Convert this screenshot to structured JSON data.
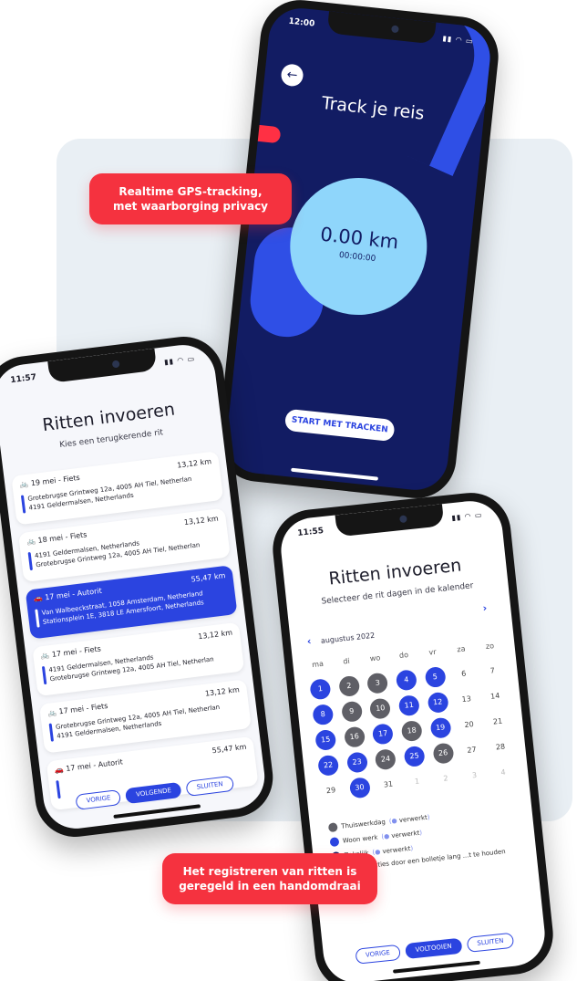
{
  "colors": {
    "brand_blue": "#2b44e0",
    "navy": "#121c63",
    "light_blue": "#8fd6fb",
    "red": "#f5323f",
    "panel": "#e9eff4"
  },
  "badges": {
    "gps": [
      "Realtime GPS-tracking,",
      "met waarborging privacy"
    ],
    "register": [
      "Het registreren van ritten is",
      "geregeld in een handomdraai"
    ]
  },
  "track": {
    "status_time": "12:00",
    "back_icon": "arrow-left-icon",
    "title": "Track je reis",
    "distance": "0.00 km",
    "duration": "00:00:00",
    "start_button": "START MET TRACKEN"
  },
  "list": {
    "status_time": "11:57",
    "title": "Ritten invoeren",
    "subtitle": "Kies een terugkerende rit",
    "rides": [
      {
        "label": "19 mei - Fiets",
        "icon": "bike-icon",
        "km": "13,12 km",
        "from": "Grotebrugse Grintweg 12a, 4005 AH Tiel, Netherlan",
        "to": "4191 Geldermalsen, Netherlands",
        "active": false
      },
      {
        "label": "18 mei - Fiets",
        "icon": "bike-icon",
        "km": "13,12 km",
        "from": "4191 Geldermalsen, Netherlands",
        "to": "Grotebrugse Grintweg 12a, 4005 AH Tiel, Netherlan",
        "active": false
      },
      {
        "label": "17 mei - Autorit",
        "icon": "car-icon",
        "km": "55,47 km",
        "from": "Van Walbeeckstraat, 1058 Amsterdam, Netherland",
        "to": "Stationsplein 1E, 3818 LE Amersfoort, Netherlands",
        "active": true
      },
      {
        "label": "17 mei - Fiets",
        "icon": "bike-icon",
        "km": "13,12 km",
        "from": "4191 Geldermalsen, Netherlands",
        "to": "Grotebrugse Grintweg 12a, 4005 AH Tiel, Netherlan",
        "active": false
      },
      {
        "label": "17 mei - Fiets",
        "icon": "bike-icon",
        "km": "13,12 km",
        "from": "Grotebrugse Grintweg 12a, 4005 AH Tiel, Netherlan",
        "to": "4191 Geldermalsen, Netherlands",
        "active": false
      },
      {
        "label": "17 mei - Autorit",
        "icon": "car-icon",
        "km": "55,47 km",
        "from": "",
        "to": "",
        "active": false
      }
    ],
    "buttons": {
      "prev": "VORIGE",
      "next": "VOLGENDE",
      "close": "SLUITEN"
    }
  },
  "calendar": {
    "status_time": "11:55",
    "title": "Ritten invoeren",
    "subtitle": "Selecteer de rit dagen in de kalender",
    "month": "augustus 2022",
    "weekdays": [
      "ma",
      "di",
      "wo",
      "do",
      "vr",
      "za",
      "zo"
    ],
    "weeks": [
      [
        [
          "1",
          "blue"
        ],
        [
          "2",
          "grey"
        ],
        [
          "3",
          "grey"
        ],
        [
          "4",
          "blue"
        ],
        [
          "5",
          "blue"
        ],
        [
          "6",
          ""
        ],
        [
          "7",
          ""
        ]
      ],
      [
        [
          "8",
          "blue"
        ],
        [
          "9",
          "grey"
        ],
        [
          "10",
          "grey"
        ],
        [
          "11",
          "blue"
        ],
        [
          "12",
          "blue"
        ],
        [
          "13",
          ""
        ],
        [
          "14",
          ""
        ]
      ],
      [
        [
          "15",
          "blue"
        ],
        [
          "16",
          "grey"
        ],
        [
          "17",
          "blue"
        ],
        [
          "18",
          "grey"
        ],
        [
          "19",
          "blue"
        ],
        [
          "20",
          ""
        ],
        [
          "21",
          ""
        ]
      ],
      [
        [
          "22",
          "blue"
        ],
        [
          "23",
          "blue"
        ],
        [
          "24",
          "grey"
        ],
        [
          "25",
          "blue"
        ],
        [
          "26",
          "grey"
        ],
        [
          "27",
          ""
        ],
        [
          "28",
          ""
        ]
      ],
      [
        [
          "29",
          ""
        ],
        [
          "30",
          "blue"
        ],
        [
          "31",
          ""
        ],
        [
          "1",
          "faded"
        ],
        [
          "2",
          "faded"
        ],
        [
          "3",
          "faded"
        ],
        [
          "4",
          "faded"
        ]
      ]
    ],
    "legend": [
      {
        "label": "Thuiswerkdag",
        "tag": "verwerkt",
        "color": "#5f5f66"
      },
      {
        "label": "Woon werk",
        "tag": "verwerkt",
        "color": "#2b44e0"
      },
      {
        "label": "Zakelijk",
        "tag": "verwerkt",
        "color": "#121c63"
      }
    ],
    "note": "...alle transacties door een bolletje lang ...t te houden",
    "buttons": {
      "prev": "VORIGE",
      "done": "VOLTOOIEN",
      "close": "SLUITEN"
    }
  }
}
